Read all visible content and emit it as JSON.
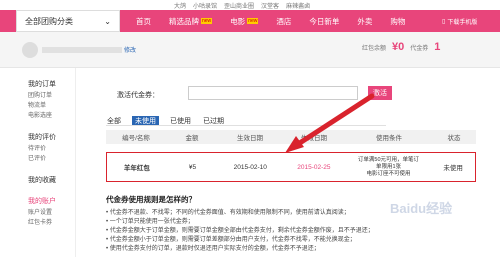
{
  "top_links": [
    "大鸽",
    "小咕录馆",
    "歪山商业圈",
    "汉堂客",
    "麻辣酱卤"
  ],
  "category": {
    "label": "全部团购分类"
  },
  "nav": [
    {
      "label": "首页",
      "tag": ""
    },
    {
      "label": "精选品牌",
      "tag": "new"
    },
    {
      "label": "电影",
      "tag": "new"
    },
    {
      "label": "酒店",
      "tag": ""
    },
    {
      "label": "今日新单",
      "tag": ""
    },
    {
      "label": "外卖",
      "tag": ""
    },
    {
      "label": "购物",
      "tag": ""
    }
  ],
  "app_link": "下载手机版",
  "user": {
    "link": "修改"
  },
  "balances": {
    "redpack_label": "红包余额",
    "redpack_value": "¥0",
    "coupon_label": "代金券",
    "coupon_value": "1"
  },
  "sidebar": {
    "groups": [
      {
        "title": "我的订单",
        "items": [
          "团购订单",
          "物流单",
          "电影选座"
        ]
      },
      {
        "title": "我的评价",
        "items": [
          "待评价",
          "已评价"
        ]
      },
      {
        "title": "我的收藏",
        "items": []
      },
      {
        "title": "我的账户",
        "items": [
          "账户设置",
          "红包卡券"
        ]
      }
    ],
    "active": "我的账户"
  },
  "activate": {
    "label": "激活代金券：",
    "button": "激活"
  },
  "tabs": [
    "全部",
    "未使用",
    "已使用",
    "已过期"
  ],
  "active_tab": "未使用",
  "table": {
    "headers": [
      "编号/名称",
      "金额",
      "生效日期",
      "失效日期",
      "使用条件",
      "状态"
    ],
    "rows": [
      {
        "name": "羊年红包",
        "amount": "¥5",
        "start": "2015-02-10",
        "end": "2015-02-25",
        "condition_1": "订单满50元可用，单笔订",
        "condition_2": "单限用1张",
        "condition_3": "电影订座不可使用",
        "status": "未使用"
      }
    ]
  },
  "rules": {
    "title": "代金券使用规则是怎样的？",
    "lines": [
      "代金券不退款、不找零；不同的代金券面值、有效期和使用限制不同，使用前请认真阅读；",
      "一个订单只能使用一张代金券；",
      "代金券金额大于订单金额，则需要订单金额全部由代金券支付，剩余代金券金额作废，且不予退还；",
      "代金券金额小于订单金额，则需要订单差额部分由用户支付，代金券不找零，不能兑换现金；",
      "使用代金券支付的订单，退款时仅退还用户实际支付的金额，代金券不予退还；"
    ]
  },
  "watermark": "Baidu经验",
  "colors": {
    "brand": "#e8457b",
    "highlight": "#d9232d"
  }
}
